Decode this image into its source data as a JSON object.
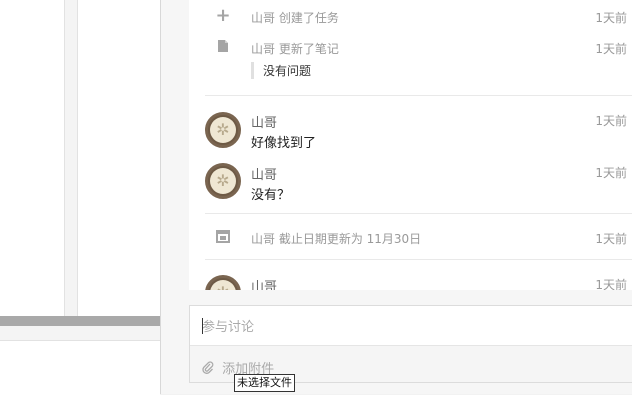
{
  "feed": {
    "activities": [
      {
        "icon": "plus-icon",
        "text": "山哥 创建了任务",
        "time": "1天前"
      },
      {
        "icon": "note-icon",
        "text": "山哥 更新了笔记",
        "time": "1天前",
        "quote": "没有问题"
      },
      {
        "icon": "calendar-icon",
        "text": "山哥 截止日期更新为 11月30日",
        "time": "1天前"
      }
    ],
    "comments": [
      {
        "author": "山哥",
        "body": "好像找到了",
        "time": "1天前"
      },
      {
        "author": "山哥",
        "body": "没有？",
        "time": "1天前"
      },
      {
        "author": "山哥",
        "body": "",
        "time": "1天前"
      }
    ]
  },
  "composer": {
    "placeholder": "参与讨论",
    "attach_label": "添加附件",
    "file_tooltip": "未选择文件"
  }
}
